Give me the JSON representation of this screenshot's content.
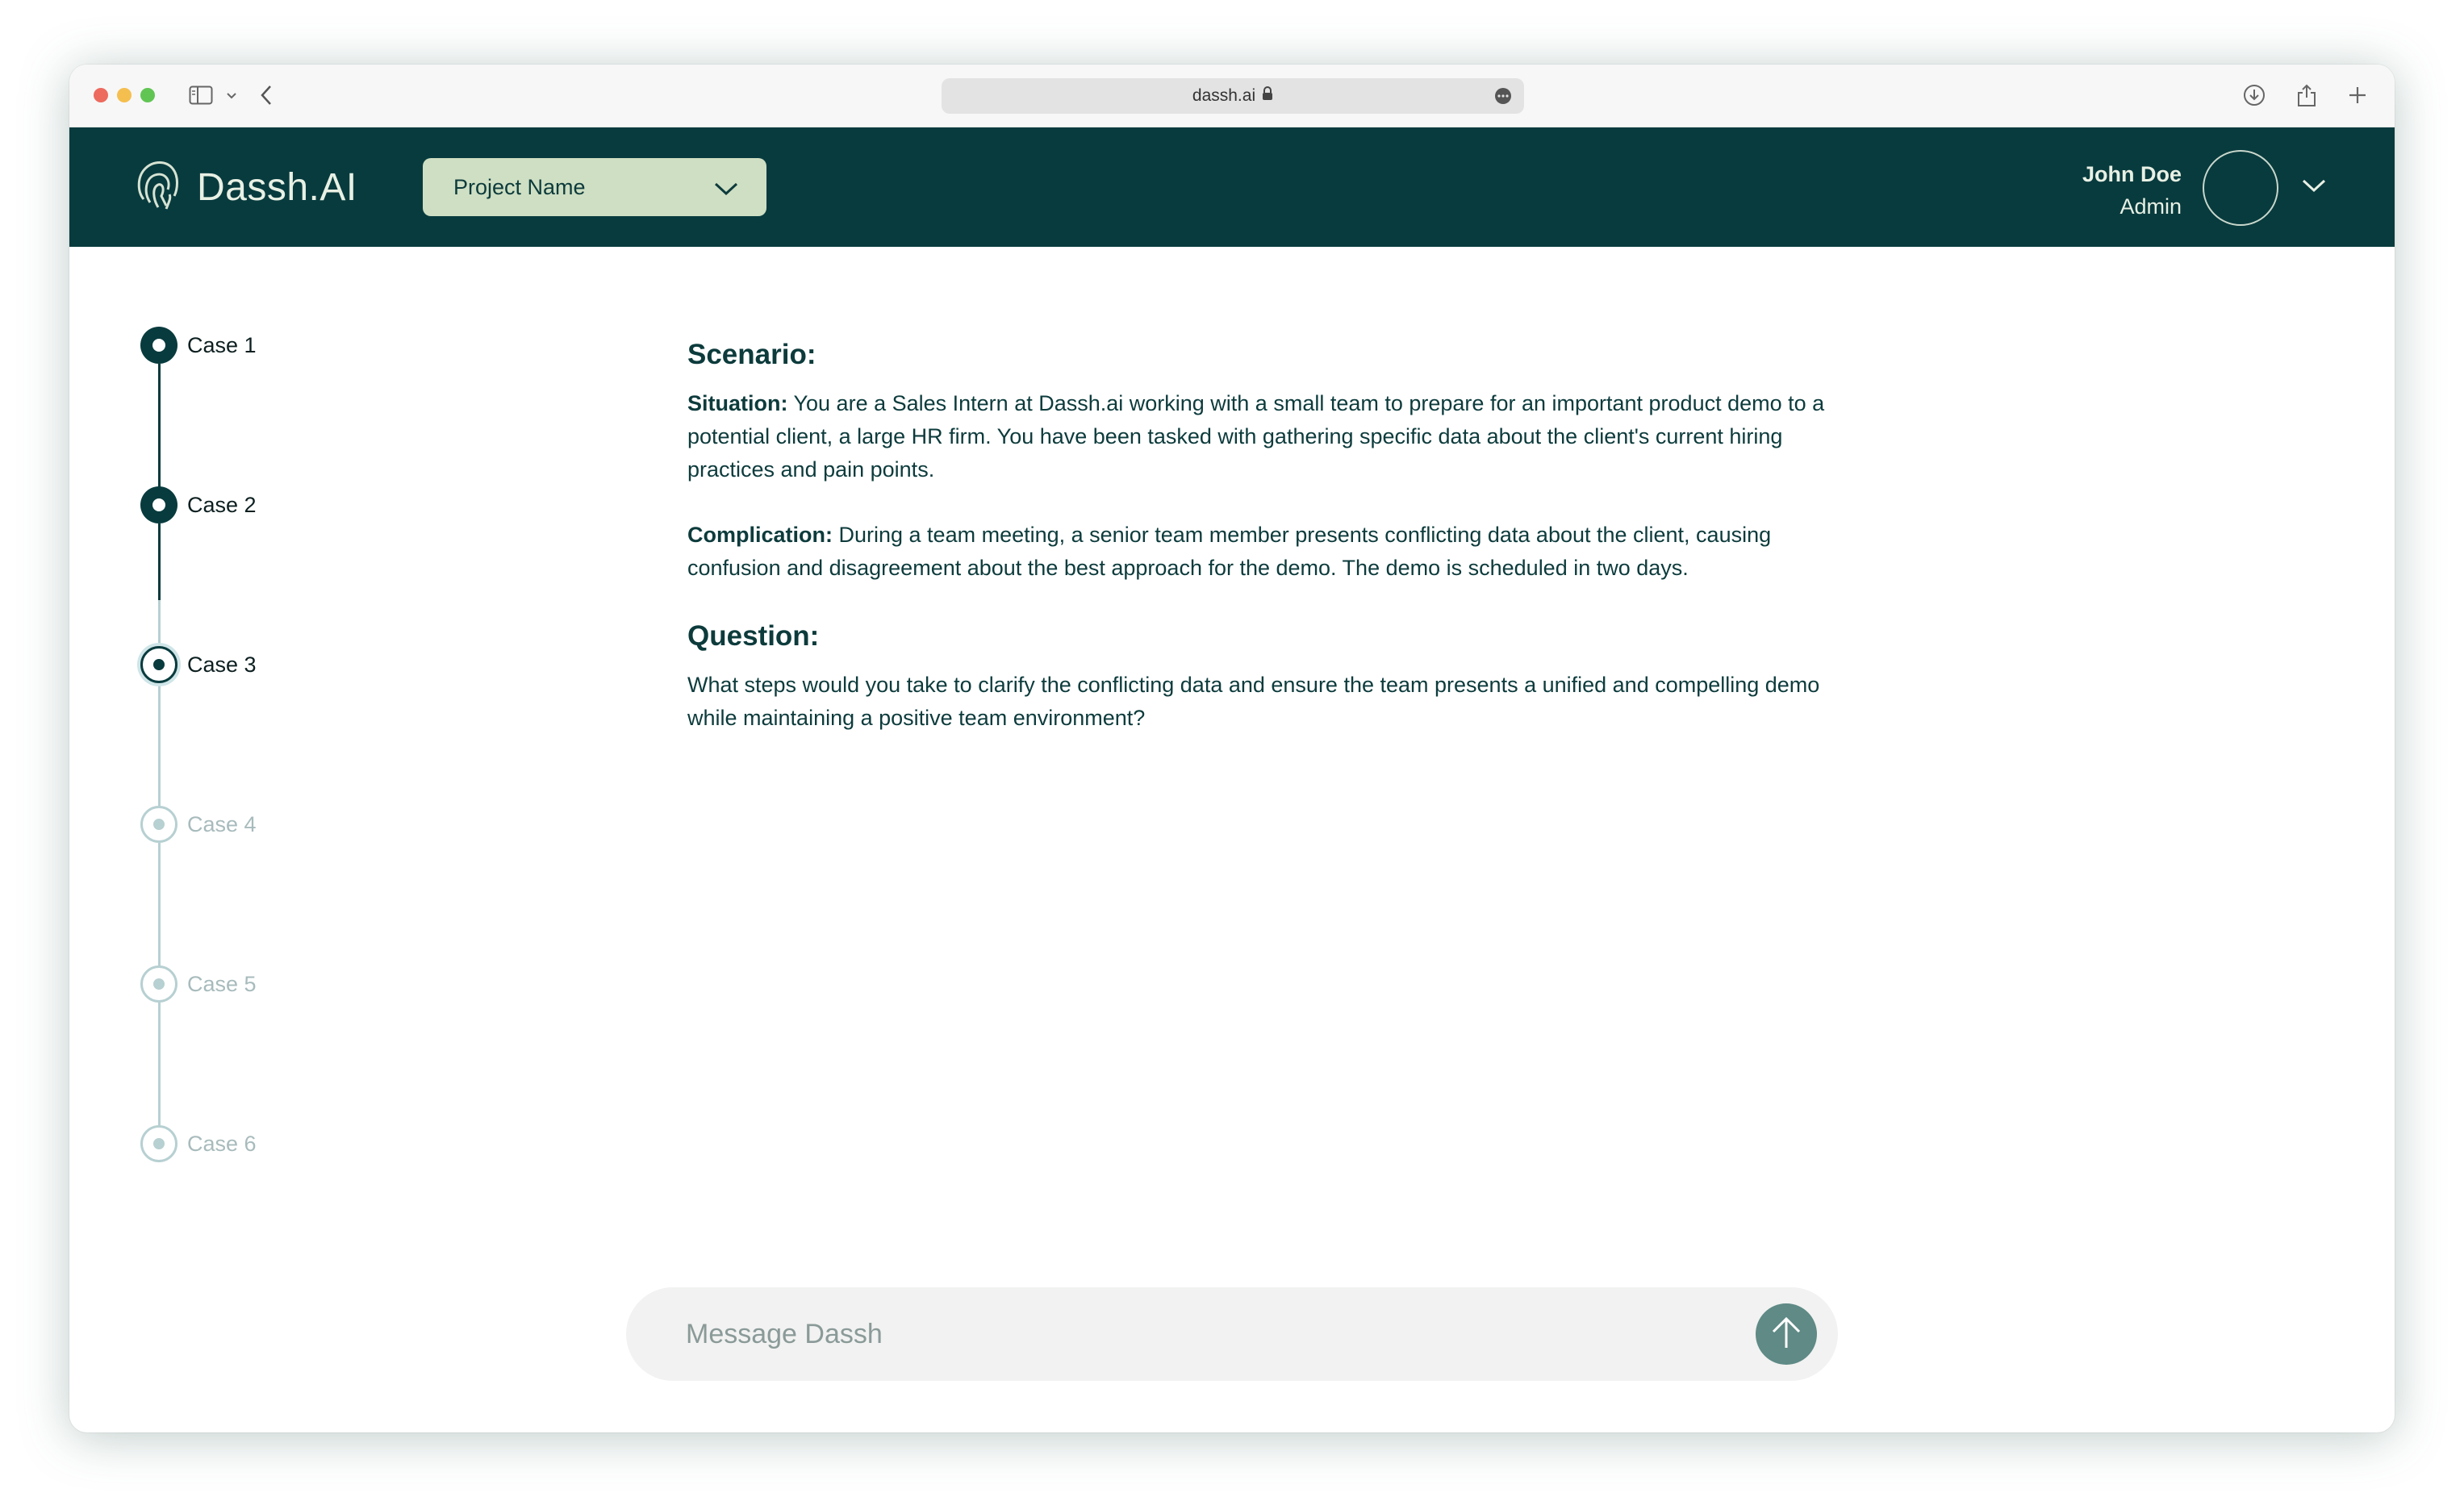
{
  "browser": {
    "url": "dassh.ai"
  },
  "header": {
    "brand": "Dassh.AI",
    "project_select": "Project Name",
    "user_name": "John Doe",
    "user_role": "Admin"
  },
  "steps": [
    {
      "label": "Case 1",
      "state": "done"
    },
    {
      "label": "Case 2",
      "state": "done"
    },
    {
      "label": "Case 3",
      "state": "active"
    },
    {
      "label": "Case 4",
      "state": "todo"
    },
    {
      "label": "Case 5",
      "state": "todo"
    },
    {
      "label": "Case 6",
      "state": "todo"
    }
  ],
  "content": {
    "scenario_heading": "Scenario:",
    "situation_label": "Situation:",
    "situation_text": " You are a Sales Intern at Dassh.ai working with a small team to prepare for an important product demo to a potential client, a large HR firm. You have been tasked with gathering specific data about the client's current hiring practices and pain points.",
    "complication_label": "Complication:",
    "complication_text": " During a team meeting, a senior team member presents conflicting data about the client, causing confusion and disagreement about the best approach for the demo. The demo is scheduled in two days.",
    "question_heading": "Question:",
    "question_text": "What steps would you take to clarify the conflicting data and ensure the team presents a unified and compelling demo while maintaining a positive team environment?"
  },
  "message": {
    "placeholder": "Message Dassh"
  },
  "colors": {
    "header_bg": "#083b3e",
    "select_bg": "#cfdfc3",
    "send_button": "#5f8a86"
  }
}
